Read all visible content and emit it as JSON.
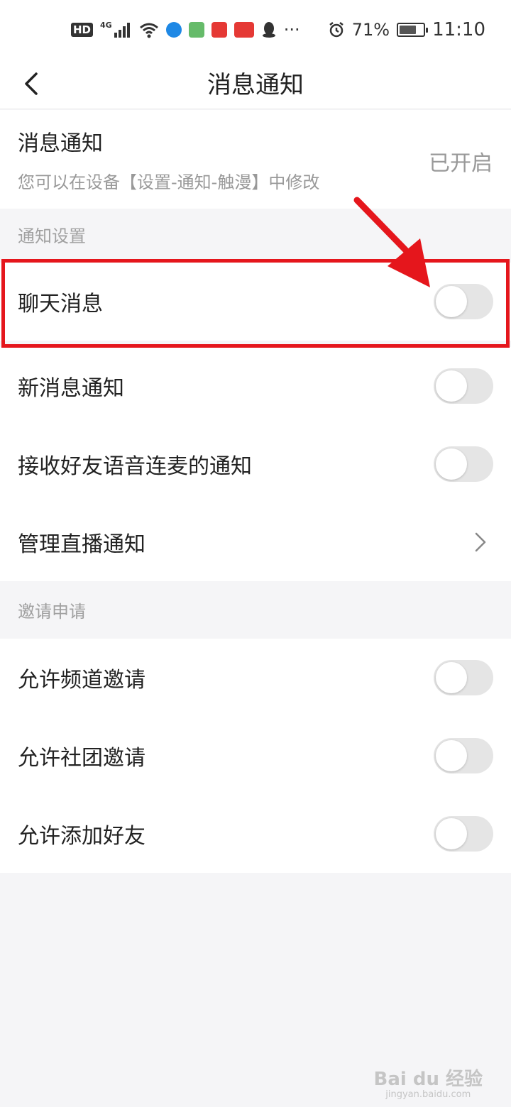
{
  "status_bar": {
    "hd": "HD",
    "network": "4G",
    "more": "···",
    "battery_pct": "71%",
    "battery_level": 0.71,
    "time": "11:10"
  },
  "nav": {
    "title": "消息通知"
  },
  "notify": {
    "title": "消息通知",
    "subtitle": "您可以在设备【设置-通知-触漫】中修改",
    "status": "已开启"
  },
  "sections": [
    {
      "header": "通知设置",
      "rows": [
        {
          "label": "聊天消息",
          "type": "toggle",
          "on": false
        },
        {
          "label": "新消息通知",
          "type": "toggle",
          "on": false
        },
        {
          "label": "接收好友语音连麦的通知",
          "type": "toggle",
          "on": false
        },
        {
          "label": "管理直播通知",
          "type": "link"
        }
      ]
    },
    {
      "header": "邀请申请",
      "rows": [
        {
          "label": "允许频道邀请",
          "type": "toggle",
          "on": false
        },
        {
          "label": "允许社团邀请",
          "type": "toggle",
          "on": false
        },
        {
          "label": "允许添加好友",
          "type": "toggle",
          "on": false
        }
      ]
    }
  ],
  "colors": {
    "highlight": "#e5161c",
    "toggle_off": "#e5e5e5",
    "background": "#f5f5f7"
  },
  "watermark": {
    "main": "Bai du 经验",
    "sub": "jingyan.baidu.com"
  }
}
